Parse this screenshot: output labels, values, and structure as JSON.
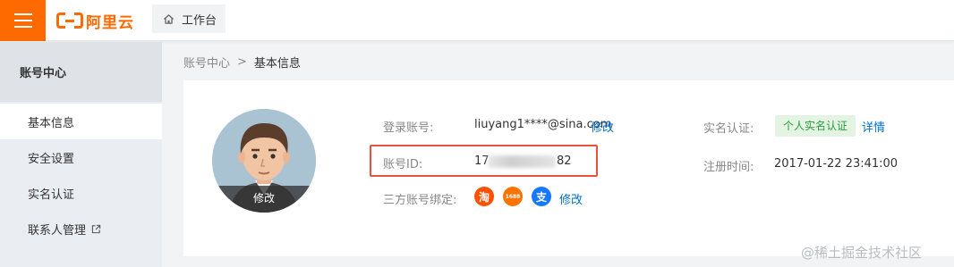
{
  "header": {
    "logo_text": "阿里云",
    "workbench_label": "工作台"
  },
  "sidebar": {
    "title": "账号中心",
    "items": [
      {
        "label": "基本信息",
        "active": true
      },
      {
        "label": "安全设置"
      },
      {
        "label": "实名认证"
      },
      {
        "label": "联系人管理"
      }
    ]
  },
  "breadcrumb": {
    "parent": "账号中心",
    "separator": ">",
    "current": "基本信息"
  },
  "profile": {
    "avatar_edit_label": "修改",
    "login_account_label": "登录账号:",
    "login_account_value": "liuyang1****@sina.com",
    "login_account_edit": "修改",
    "account_id_label": "账号ID:",
    "account_id_prefix": "17",
    "account_id_suffix": "82",
    "third_party_label": "三方账号绑定:",
    "third_party_edit": "修改",
    "third_party_icons": [
      {
        "name": "taobao",
        "glyph": "淘",
        "color": "#ff5000"
      },
      {
        "name": "1688",
        "glyph": "1688",
        "color": "#ff7300"
      },
      {
        "name": "alipay",
        "glyph": "支",
        "color": "#1677ff"
      }
    ],
    "realname_label": "实名认证:",
    "realname_badge": "个人实名认证",
    "realname_details": "详情",
    "register_time_label": "注册时间:",
    "register_time_value": "2017-01-22 23:41:00"
  },
  "watermark": "@稀土掘金技术社区",
  "colors": {
    "brand": "#ff6a00",
    "link": "#0070cc",
    "highlight_box": "#e8523f",
    "badge_bg": "#e3f4e3",
    "badge_text": "#2e9a3f"
  }
}
